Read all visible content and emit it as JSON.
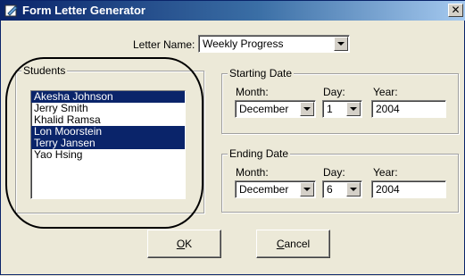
{
  "window": {
    "title": "Form Letter Generator",
    "close_glyph": "✕",
    "title_gradient": [
      "#0A246A",
      "#A6CAF0"
    ],
    "selection_color": "#0A246A"
  },
  "letter_name": {
    "label": "Letter Name:",
    "value": "Weekly Progress"
  },
  "students": {
    "title": "Students",
    "items": [
      {
        "name": "Akesha Johnson",
        "selected": true
      },
      {
        "name": "Jerry Smith",
        "selected": false
      },
      {
        "name": "Khalid Ramsa",
        "selected": false
      },
      {
        "name": "Lon Moorstein",
        "selected": true
      },
      {
        "name": "Terry Jansen",
        "selected": true
      },
      {
        "name": "Yao Hsing",
        "selected": false
      }
    ]
  },
  "starting_date": {
    "title": "Starting Date",
    "month_label": "Month:",
    "day_label": "Day:",
    "year_label": "Year:",
    "month": "December",
    "day": "1",
    "year": "2004"
  },
  "ending_date": {
    "title": "Ending Date",
    "month_label": "Month:",
    "day_label": "Day:",
    "year_label": "Year:",
    "month": "December",
    "day": "6",
    "year": "2004"
  },
  "buttons": {
    "ok_mnemonic": "O",
    "ok_rest": "K",
    "cancel_mnemonic": "C",
    "cancel_rest": "ancel"
  },
  "icons": [
    "app-icon",
    "close-icon",
    "chevron-down-icon"
  ]
}
